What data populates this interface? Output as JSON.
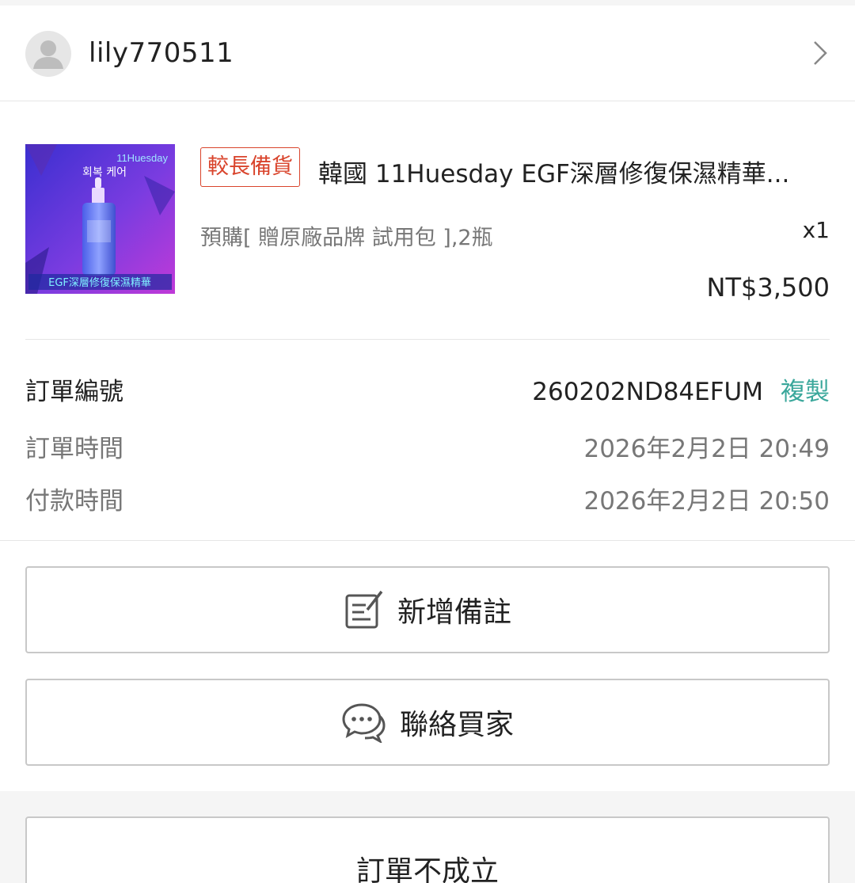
{
  "buyer": {
    "username": "lily770511"
  },
  "product": {
    "tag": "較長備貨",
    "title": "韓國 11Huesday EGF深層修復保濕精華...",
    "variant": "預購[ 贈原廠品牌 試用包 ],2瓶",
    "quantity": "x1",
    "price": "NT$3,500",
    "image_text": {
      "brand": "11Huesday",
      "korean": "회복 케어",
      "caption": "EGF深層修復保濕精華"
    }
  },
  "order_info": {
    "order_no_label": "訂單編號",
    "order_no": "260202ND84EFUM",
    "copy_label": "複製",
    "order_time_label": "訂單時間",
    "order_time": "2026年2月2日 20:49",
    "payment_time_label": "付款時間",
    "payment_time": "2026年2月2日 20:50"
  },
  "actions": {
    "add_note": {
      "label": "新增備註",
      "icon": "note-edit-icon"
    },
    "contact_buyer": {
      "label": "聯絡買家",
      "icon": "chat-bubble-icon"
    }
  },
  "footer": {
    "cancel_label": "訂單不成立"
  },
  "colors": {
    "tag": "#d9442c",
    "copy": "#3aa79b",
    "background": "#f5f5f5"
  }
}
